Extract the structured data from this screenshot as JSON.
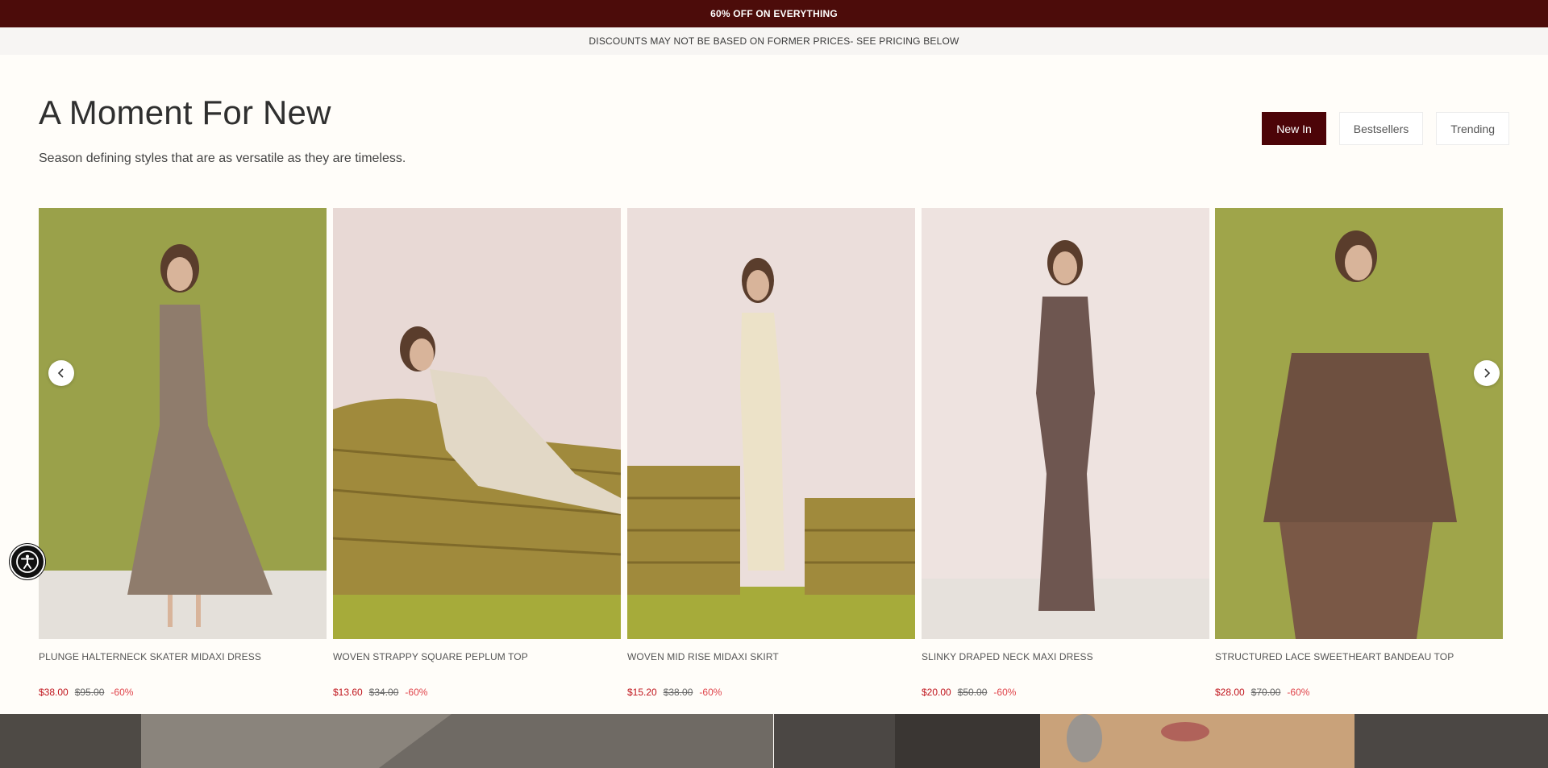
{
  "promo": {
    "text": "60% OFF ON EVERYTHING"
  },
  "notice": {
    "text": "DISCOUNTS MAY NOT BE BASED ON FORMER PRICES- SEE PRICING BELOW"
  },
  "section": {
    "title": "A Moment For New",
    "subtitle": "Season defining styles that are as versatile as they are timeless."
  },
  "tabs": [
    {
      "label": "New In",
      "active": true
    },
    {
      "label": "Bestsellers",
      "active": false
    },
    {
      "label": "Trending",
      "active": false
    }
  ],
  "products": [
    {
      "name": "PLUNGE HALTERNECK SKATER MIDAXI DRESS",
      "price": "$38.00",
      "was": "$95.00",
      "discount": "-60%",
      "bg": "#9aa14a",
      "garment": "#8f7c6c"
    },
    {
      "name": "WOVEN STRAPPY SQUARE PEPLUM TOP",
      "price": "$13.60",
      "was": "$34.00",
      "discount": "-60%",
      "bg": "#e8d9d5",
      "garment": "#e2d8c6"
    },
    {
      "name": "WOVEN MID RISE MIDAXI SKIRT",
      "price": "$15.20",
      "was": "$38.00",
      "discount": "-60%",
      "bg": "#ebdedb",
      "garment": "#ece2c8"
    },
    {
      "name": "SLINKY DRAPED NECK MAXI DRESS",
      "price": "$20.00",
      "was": "$50.00",
      "discount": "-60%",
      "bg": "#eee3e0",
      "garment": "#6e5650"
    },
    {
      "name": "STRUCTURED LACE SWEETHEART BANDEAU TOP",
      "price": "$28.00",
      "was": "$70.00",
      "discount": "-60%",
      "bg": "#9fa54a",
      "garment": "#6e5040"
    }
  ],
  "icons": {
    "prev": "chevron-left-icon",
    "next": "chevron-right-icon",
    "accessibility": "accessibility-icon"
  },
  "colors": {
    "brand": "#4c0c0a",
    "sale": "#c0141c",
    "page_bg": "#fffdf9"
  }
}
